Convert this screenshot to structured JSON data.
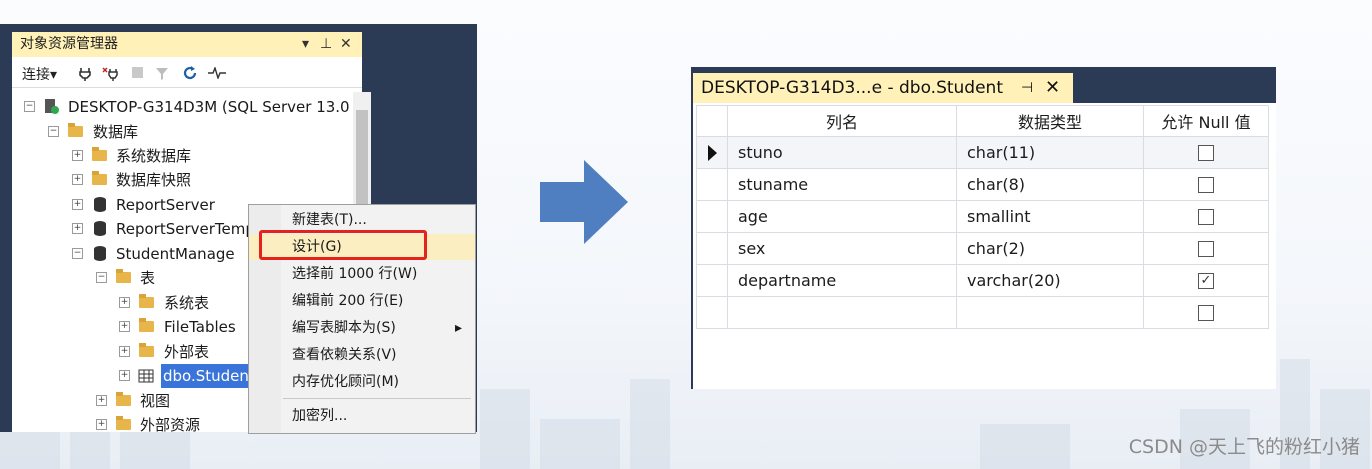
{
  "object_explorer": {
    "title": "对象资源管理器",
    "title_controls": {
      "dropdown": "▾",
      "pin": "⊥",
      "close": "✕"
    },
    "toolbar": {
      "connect": "连接",
      "connect_arrow": "▾"
    },
    "tree": [
      {
        "label": "DESKTOP-G314D3M (SQL Server 13.0",
        "expander": "⊟",
        "icon": "server-icon"
      },
      {
        "label": "数据库",
        "expander": "⊟",
        "icon": "folder-icon"
      },
      {
        "label": "系统数据库",
        "expander": "⊞",
        "icon": "folder-icon"
      },
      {
        "label": "数据库快照",
        "expander": "⊞",
        "icon": "folder-icon"
      },
      {
        "label": "ReportServer",
        "expander": "⊞",
        "icon": "database-icon"
      },
      {
        "label": "ReportServerTemp",
        "expander": "⊞",
        "icon": "database-icon"
      },
      {
        "label": "StudentManage",
        "expander": "⊟",
        "icon": "database-icon"
      },
      {
        "label": "表",
        "expander": "⊟",
        "icon": "folder-icon"
      },
      {
        "label": "系统表",
        "expander": "⊞",
        "icon": "folder-icon"
      },
      {
        "label": "FileTables",
        "expander": "⊞",
        "icon": "folder-icon"
      },
      {
        "label": "外部表",
        "expander": "⊞",
        "icon": "folder-icon"
      },
      {
        "label": "dbo.Student",
        "expander": "⊞",
        "icon": "table-icon"
      },
      {
        "label": "视图",
        "expander": "⊞",
        "icon": "folder-icon"
      },
      {
        "label": "外部资源",
        "expander": "⊞",
        "icon": "folder-icon"
      }
    ],
    "context_menu": [
      "新建表(T)...",
      "设计(G)",
      "选择前 1000 行(W)",
      "编辑前 200 行(E)",
      "编写表脚本为(S)",
      "查看依赖关系(V)",
      "内存优化顾问(M)",
      "加密列..."
    ],
    "submenu_arrow": "▸"
  },
  "designer": {
    "tab_title": "DESKTOP-G314D3...e - dbo.Student",
    "tab_pin": "⊣",
    "tab_close": "✕",
    "columns": [
      "列名",
      "数据类型",
      "允许 Null 值"
    ],
    "rows": [
      {
        "name": "stuno",
        "type": "char(11)",
        "allow_null": false
      },
      {
        "name": "stuname",
        "type": "char(8)",
        "allow_null": false
      },
      {
        "name": "age",
        "type": "smallint",
        "allow_null": false
      },
      {
        "name": "sex",
        "type": "char(2)",
        "allow_null": false
      },
      {
        "name": "departname",
        "type": "varchar(20)",
        "allow_null": true
      },
      {
        "name": "",
        "type": "",
        "allow_null": false
      }
    ],
    "check_mark": "✓"
  },
  "colors": {
    "panel_dark": "#2b3a55",
    "title_yellow": "#fff1b8",
    "arrow_blue": "#4f7fc0",
    "highlight_red": "#e5231b"
  },
  "watermark": "CSDN @天上飞的粉红小猪"
}
